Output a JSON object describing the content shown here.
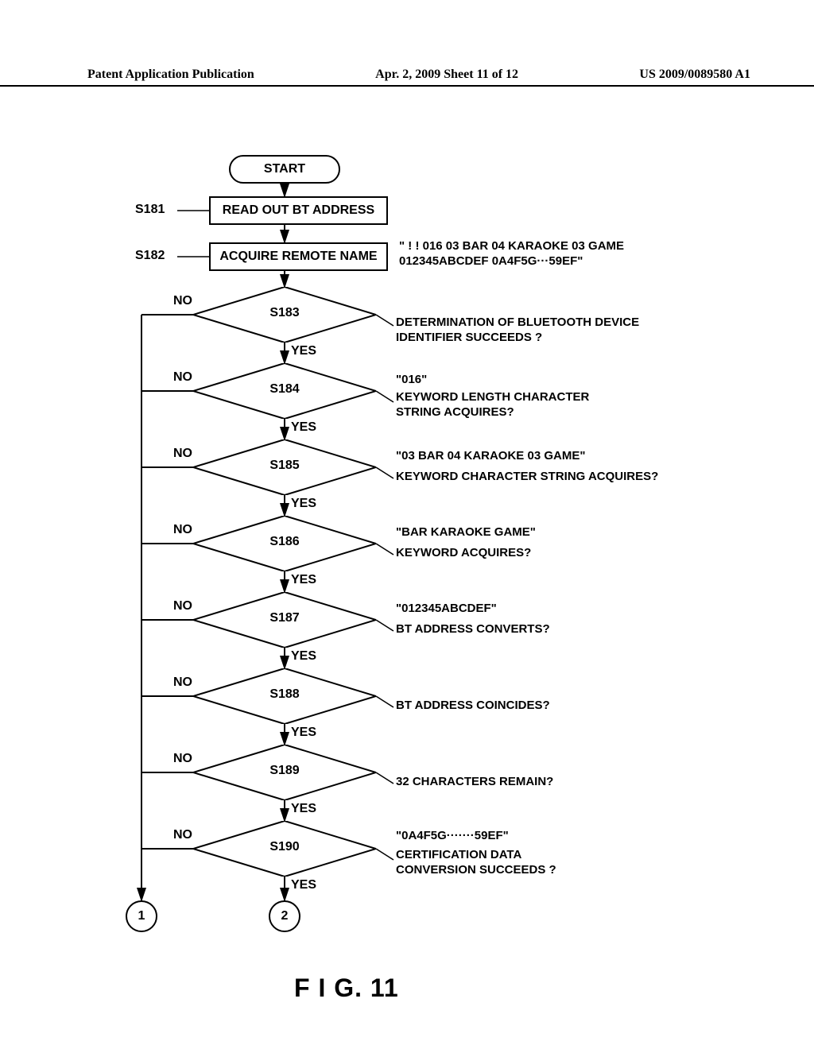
{
  "header": {
    "left": "Patent Application Publication",
    "center": "Apr. 2, 2009  Sheet 11 of 12",
    "right": "US 2009/0089580 A1"
  },
  "figure_caption": "F I G.  11",
  "flow": {
    "start": "START",
    "process_s181": "READ OUT BT ADDRESS",
    "process_s182": "ACQUIRE REMOTE NAME",
    "ref_s181": "S181",
    "ref_s182": "S182",
    "note_s182": "\" ! ! 016 03 BAR 04 KARAOKE 03 GAME\n012345ABCDEF 0A4F5G···59EF\"",
    "d_s183": {
      "ref": "S183",
      "text": "DETERMINATION OF BLUETOOTH DEVICE\nIDENTIFIER SUCCEEDS ?",
      "yes": "YES",
      "no": "NO"
    },
    "d_s184": {
      "ref": "S184",
      "example": "\"016\"",
      "text": "KEYWORD LENGTH CHARACTER\nSTRING ACQUIRES?",
      "yes": "YES",
      "no": "NO"
    },
    "d_s185": {
      "ref": "S185",
      "example": "\"03 BAR 04 KARAOKE 03 GAME\"",
      "text": "KEYWORD CHARACTER STRING ACQUIRES?",
      "yes": "YES",
      "no": "NO"
    },
    "d_s186": {
      "ref": "S186",
      "example": "\"BAR KARAOKE GAME\"",
      "text": "KEYWORD ACQUIRES?",
      "yes": "YES",
      "no": "NO"
    },
    "d_s187": {
      "ref": "S187",
      "example": "\"012345ABCDEF\"",
      "text": "BT ADDRESS CONVERTS?",
      "yes": "YES",
      "no": "NO"
    },
    "d_s188": {
      "ref": "S188",
      "text": "BT ADDRESS COINCIDES?",
      "yes": "YES",
      "no": "NO"
    },
    "d_s189": {
      "ref": "S189",
      "text": "32 CHARACTERS REMAIN?",
      "yes": "YES",
      "no": "NO"
    },
    "d_s190": {
      "ref": "S190",
      "example": "\"0A4F5G·······59EF\"",
      "text": "CERTIFICATION DATA\nCONVERSION SUCCEEDS ?",
      "yes": "YES",
      "no": "NO"
    },
    "conn1": "1",
    "conn2": "2"
  }
}
